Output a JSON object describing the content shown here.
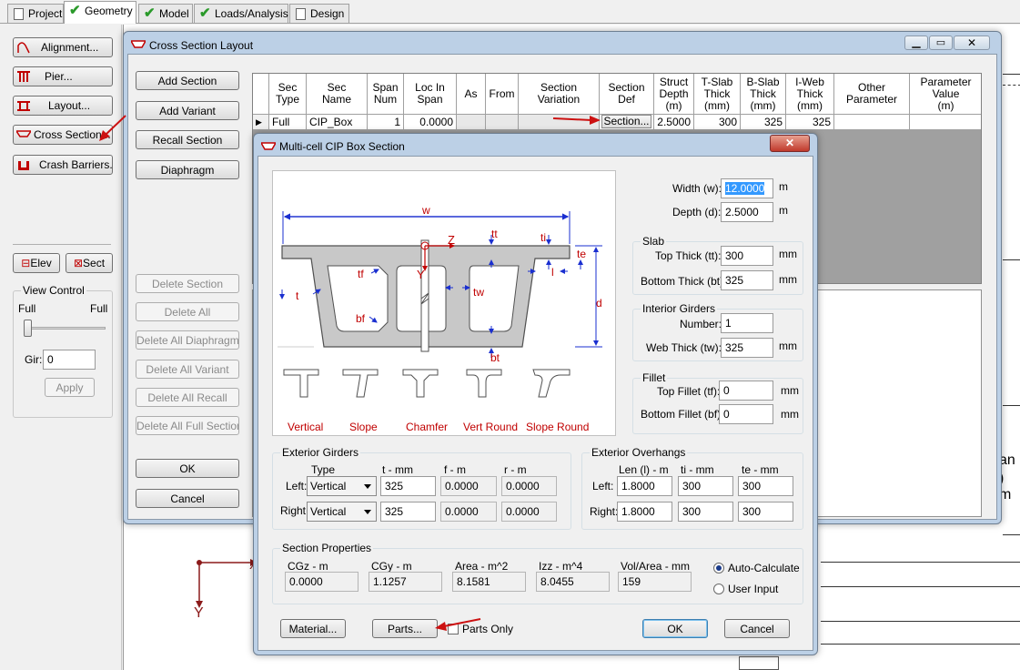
{
  "tabs": [
    {
      "label": "Project"
    },
    {
      "label": "Geometry"
    },
    {
      "label": "Model"
    },
    {
      "label": "Loads/Analysis"
    },
    {
      "label": "Design"
    }
  ],
  "left_panel": {
    "buttons": [
      "Alignment...",
      "Pier...",
      "Layout...",
      "Cross Section...",
      "Crash Barriers..."
    ],
    "elev": "Elev",
    "sect": "Sect",
    "view_control": "View Control",
    "full_left": "Full",
    "full_right": "Full",
    "gir_label": "Gir:",
    "gir_value": "0",
    "apply": "Apply"
  },
  "cross_section_window": {
    "title": "Cross Section Layout",
    "buttons": [
      "Add Section",
      "Add Variant",
      "Recall Section",
      "Diaphragm"
    ],
    "disabled_buttons": [
      "Delete Section",
      "Delete All",
      "Delete All Diaphragms",
      "Delete All Variant",
      "Delete All Recall",
      "Delete All Full Sections"
    ],
    "ok": "OK",
    "cancel": "Cancel",
    "columns": [
      "Sec\nType",
      "Sec\nName",
      "Span\nNum",
      "Loc In\nSpan",
      "As",
      "From",
      "Section\nVariation",
      "Section\nDef",
      "Struct\nDepth\n(m)",
      "T-Slab\nThick\n(mm)",
      "B-Slab\nThick\n(mm)",
      "I-Web\nThick\n(mm)",
      "Other\nParameter",
      "Parameter\nValue\n(m)"
    ],
    "row": {
      "sec_type": "Full",
      "sec_name": "CIP_Box",
      "span_num": "1",
      "loc": "0.0000",
      "def_button": "Section...",
      "depth": "2.5000",
      "tslab": "300",
      "bslab": "325",
      "iweb": "325"
    }
  },
  "background": {
    "axis_x": "X",
    "axis_y": "Y",
    "edge_text_1": "an",
    "edge_text_2": ") m"
  },
  "dialog": {
    "title": "Multi-cell CIP Box Section",
    "figure_labels": {
      "w": "w",
      "tt": "tt",
      "ti": "ti",
      "te": "te",
      "z": "Z",
      "y": "Y",
      "tf": "tf",
      "t": "t",
      "tw": "tw",
      "bf": "bf",
      "d": "d",
      "bt": "bt",
      "l": "l"
    },
    "fillet_types": [
      "Vertical",
      "Slope",
      "Chamfer",
      "Vert Round",
      "Slope Round"
    ],
    "width_label": "Width (w):",
    "width": "12.0000",
    "depth_label": "Depth (d):",
    "depth": "2.5000",
    "unit_m": "m",
    "unit_mm": "mm",
    "slab": {
      "title": "Slab",
      "top_label": "Top Thick (tt):",
      "top": "300",
      "bottom_label": "Bottom Thick (bt):",
      "bottom": "325"
    },
    "interior": {
      "title": "Interior Girders",
      "number_label": "Number:",
      "number": "1",
      "web_label": "Web Thick (tw):",
      "web": "325"
    },
    "fillet": {
      "title": "Fillet",
      "top_label": "Top Fillet (tf):",
      "top": "0",
      "bottom_label": "Bottom Fillet (bf):",
      "bottom": "0"
    },
    "exterior": {
      "title": "Exterior Girders",
      "col_type": "Type",
      "col_t": "t - mm",
      "col_f": "f - m",
      "col_r": "r - m",
      "left_label": "Left:",
      "right_label": "Right:",
      "left_type": "Vertical",
      "left_t": "325",
      "left_f": "0.0000",
      "left_r": "0.0000",
      "right_type": "Vertical",
      "right_t": "325",
      "right_f": "0.0000",
      "right_r": "0.0000"
    },
    "overhangs": {
      "title": "Exterior Overhangs",
      "col_len": "Len (l) - m",
      "col_ti": "ti - mm",
      "col_te": "te - mm",
      "left_label": "Left:",
      "right_label": "Right:",
      "left_len": "1.8000",
      "left_ti": "300",
      "left_te": "300",
      "right_len": "1.8000",
      "right_ti": "300",
      "right_te": "300"
    },
    "props": {
      "title": "Section Properties",
      "cgz_label": "CGz - m",
      "cgz": "0.0000",
      "cgy_label": "CGy - m",
      "cgy": "1.1257",
      "area_label": "Area - m^2",
      "area": "8.1581",
      "izz_label": "Izz - m^4",
      "izz": "8.0455",
      "vol_label": "Vol/Area - mm",
      "vol": "159",
      "auto": "Auto-Calculate",
      "user": "User Input"
    },
    "material": "Material...",
    "parts": "Parts...",
    "parts_only": "Parts Only",
    "ok": "OK",
    "cancel": "Cancel"
  },
  "colors": {
    "accent_red": "#c00000",
    "arrow_red": "#cc1111",
    "figure_blue": "#1a2fd0"
  }
}
